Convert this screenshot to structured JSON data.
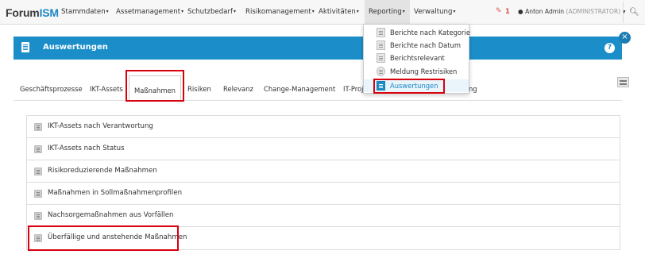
{
  "app": {
    "logo_main": "Forum",
    "logo_accent": "ISM"
  },
  "nav": {
    "items": [
      {
        "label": "Stammdaten",
        "caret": "▾"
      },
      {
        "label": "Assetmanagement",
        "caret": "▾"
      },
      {
        "label": "Schutzbedarf",
        "caret": "▾"
      },
      {
        "label": "Risikomanagement",
        "caret": "▾"
      },
      {
        "label": "Aktivitäten",
        "caret": "▾"
      },
      {
        "label": "Reporting",
        "caret": "▾"
      },
      {
        "label": "Verwaltung",
        "caret": "▾"
      }
    ],
    "notification_count": "1",
    "user_name": "Anton Admin",
    "user_role": "(ADMINISTRATOR)",
    "user_caret": "▾",
    "search_icon": "search-icon",
    "pencil_icon": "pencil-icon"
  },
  "reporting_menu": {
    "items": [
      {
        "label": "Berichte nach Kategorie",
        "icon": "report-icon"
      },
      {
        "label": "Berichte nach Datum",
        "icon": "report-icon"
      },
      {
        "label": "Berichtsrelevant",
        "icon": "report-icon"
      },
      {
        "label": "Meldung Restrisiken",
        "icon": "eye-icon"
      },
      {
        "label": "Auswertungen",
        "icon": "evaluation-icon",
        "selected": true
      }
    ]
  },
  "header": {
    "title": "Auswertungen",
    "help": "?",
    "close": "×"
  },
  "tabs": [
    {
      "label": "Geschäftsprozesse"
    },
    {
      "label": "IKT-Assets"
    },
    {
      "label": "Maßnahmen",
      "active": true
    },
    {
      "label": "Risiken"
    },
    {
      "label": "Relevanz"
    },
    {
      "label": "Change-Management"
    },
    {
      "label": "IT-Proj"
    },
    {
      "label": "ng"
    }
  ],
  "evaluations": [
    {
      "label": "IKT-Assets nach Verantwortung"
    },
    {
      "label": "IKT-Assets nach Status"
    },
    {
      "label": "Risikoreduzierende Maßnahmen"
    },
    {
      "label": "Maßnahmen in Sollmaßnahmenprofilen"
    },
    {
      "label": "Nachsorgemaßnahmen aus Vorfällen"
    },
    {
      "label": "Überfällige und anstehende Maßnahmen"
    }
  ],
  "colors": {
    "accent": "#1b8ec9",
    "highlight": "#d9000d",
    "alert": "#d9534f"
  }
}
